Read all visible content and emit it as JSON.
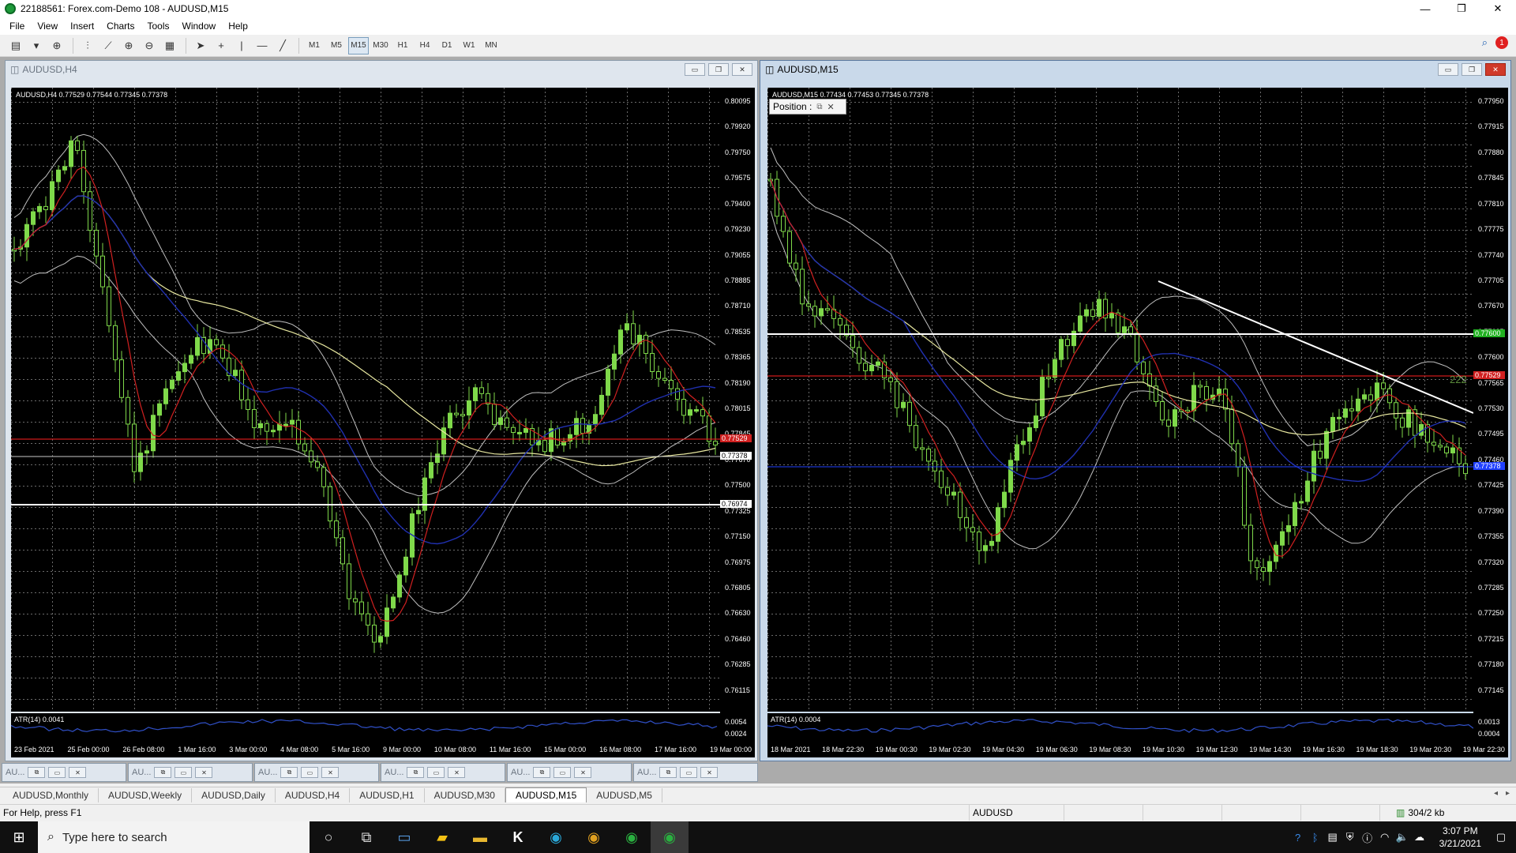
{
  "window": {
    "title": "22188561: Forex.com-Demo 108 - AUDUSD,M15",
    "minimize": "—",
    "maximize": "❐",
    "close": "✕"
  },
  "menu": [
    "File",
    "View",
    "Insert",
    "Charts",
    "Tools",
    "Window",
    "Help"
  ],
  "toolbar": {
    "timeframes": [
      "M1",
      "M5",
      "M15",
      "M30",
      "H1",
      "H4",
      "D1",
      "W1",
      "MN"
    ],
    "active_timeframe": "M15",
    "notification_count": "1"
  },
  "chart_left": {
    "title": "AUDUSD,H4",
    "ohlc": "AUDUSD,H4  0.77529 0.77544 0.77345 0.77378",
    "price_ticks": [
      "0.80095",
      "0.79920",
      "0.79750",
      "0.79575",
      "0.79400",
      "0.79230",
      "0.79055",
      "0.78885",
      "0.78710",
      "0.78535",
      "0.78365",
      "0.78190",
      "0.78015",
      "0.77845",
      "0.77670",
      "0.77500",
      "0.77325",
      "0.77150",
      "0.76975",
      "0.76805",
      "0.76630",
      "0.76460",
      "0.76285",
      "0.76115"
    ],
    "price_tags": {
      "current": "0.77378",
      "hline": "0.76974",
      "red": "0.77529"
    },
    "indicator": {
      "label": "ATR(14) 0.0041",
      "ticks": [
        "0.0054",
        "0.0024"
      ]
    },
    "time_labels": [
      "23 Feb 2021",
      "25 Feb 00:00",
      "26 Feb 08:00",
      "1 Mar 16:00",
      "3 Mar 00:00",
      "4 Mar 08:00",
      "5 Mar 16:00",
      "9 Mar 00:00",
      "10 Mar 08:00",
      "11 Mar 16:00",
      "15 Mar 00:00",
      "16 Mar 08:00",
      "17 Mar 16:00",
      "19 Mar 00:00"
    ]
  },
  "chart_right": {
    "title": "AUDUSD,M15",
    "ohlc": "AUDUSD,M15  0.77434 0.77453 0.77345 0.77378",
    "position_label": "Position :",
    "price_ticks": [
      "0.77950",
      "0.77915",
      "0.77880",
      "0.77845",
      "0.77810",
      "0.77775",
      "0.77740",
      "0.77705",
      "0.77670",
      "0.77635",
      "0.77600",
      "0.77565",
      "0.77530",
      "0.77495",
      "0.77460",
      "0.77425",
      "0.77390",
      "0.77355",
      "0.77320",
      "0.77285",
      "0.77250",
      "0.77215",
      "0.77180",
      "0.77145"
    ],
    "price_tags": {
      "green": "0.77600",
      "red": "0.77529",
      "blue": "0.77378"
    },
    "marker": "222",
    "indicator": {
      "label": "ATR(14) 0.0004",
      "ticks": [
        "0.0013",
        "0.0004"
      ]
    },
    "time_labels": [
      "18 Mar 2021",
      "18 Mar 22:30",
      "19 Mar 00:30",
      "19 Mar 02:30",
      "19 Mar 04:30",
      "19 Mar 06:30",
      "19 Mar 08:30",
      "19 Mar 10:30",
      "19 Mar 12:30",
      "19 Mar 14:30",
      "19 Mar 16:30",
      "19 Mar 18:30",
      "19 Mar 20:30",
      "19 Mar 22:30"
    ]
  },
  "minimized": [
    "AU...",
    "AU...",
    "AU...",
    "AU...",
    "AU...",
    "AU..."
  ],
  "tabs": [
    "AUDUSD,Monthly",
    "AUDUSD,Weekly",
    "AUDUSD,Daily",
    "AUDUSD,H4",
    "AUDUSD,H1",
    "AUDUSD,M30",
    "AUDUSD,M15",
    "AUDUSD,M5"
  ],
  "active_tab": "AUDUSD,M15",
  "status": {
    "help": "For Help, press F1",
    "symbol": "AUDUSD",
    "traffic": "304/2 kb"
  },
  "taskbar": {
    "search_placeholder": "Type here to search",
    "time": "3:07 PM",
    "date": "3/21/2021"
  },
  "colors": {
    "chart_bg": "#000000",
    "bull": "#7fd94a",
    "ma_red": "#d02020",
    "ma_blue": "#2030b0",
    "ma_yellow": "#e8e8a0",
    "bands": "#c0c0c0",
    "atr": "#3050c8"
  }
}
